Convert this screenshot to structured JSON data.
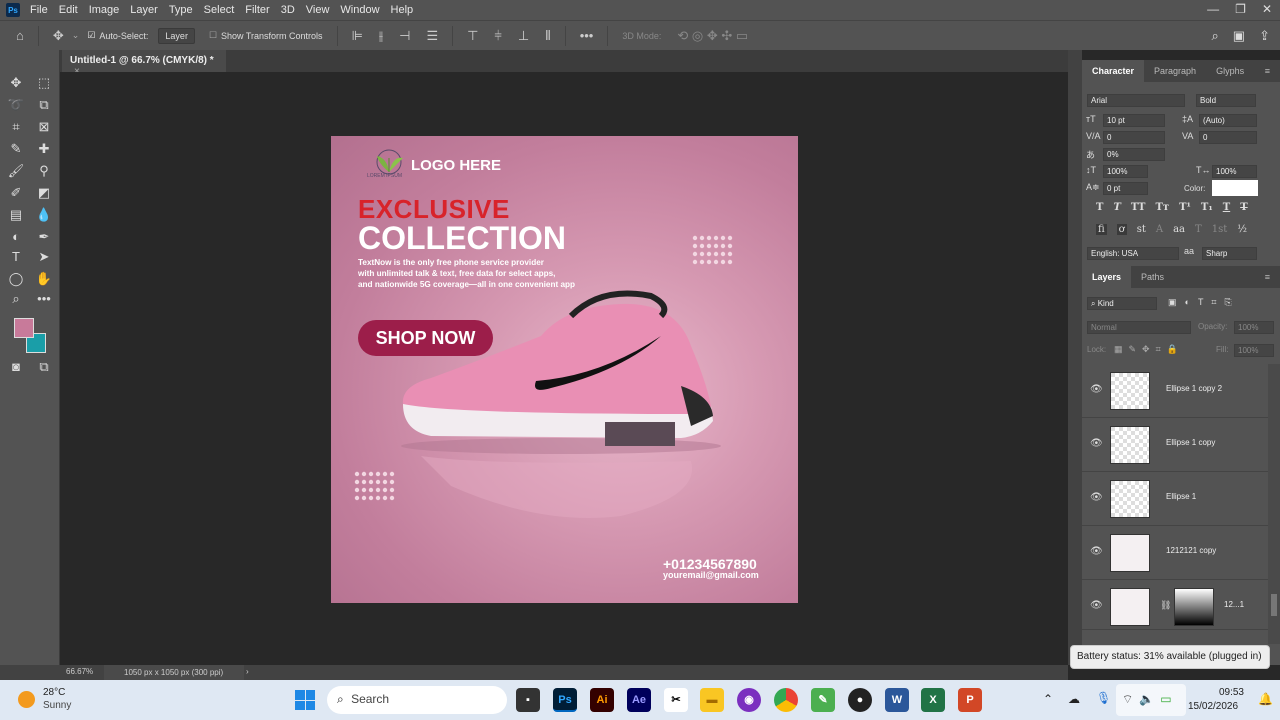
{
  "menu": [
    "File",
    "Edit",
    "Image",
    "Layer",
    "Type",
    "Select",
    "Filter",
    "3D",
    "View",
    "Window",
    "Help"
  ],
  "app_icon": "Ps",
  "options": {
    "auto_select_label": "Auto-Select:",
    "auto_select_value": "Layer",
    "show_transform": "Show Transform Controls",
    "mode_3d": "3D Mode:"
  },
  "document_tab": "Untitled-1 @ 66.7% (CMYK/8) *",
  "colors": {
    "foreground": "#c87a9a",
    "background": "#1a9ea8"
  },
  "design": {
    "logo_text": "LOGO HERE",
    "logo_caption": "LOREM IPSUM",
    "headline1": "EXCLUSIVE",
    "headline2": "COLLECTION",
    "body_lines": [
      "TextNow is the only free phone service provider",
      "with unlimited talk & text, free data for select apps,",
      "and nationwide 5G coverage—all in one convenient app"
    ],
    "cta": "SHOP NOW",
    "phone": "+01234567890",
    "email": "youremail@gmail.com"
  },
  "character": {
    "tabs": [
      "Character",
      "Paragraph",
      "Glyphs"
    ],
    "font": "Arial",
    "style": "Bold",
    "size": "10 pt",
    "leading": "(Auto)",
    "kerning": "0",
    "tracking": "0",
    "tsume": "0%",
    "vscale": "100%",
    "hscale": "100%",
    "baseline": "0 pt",
    "color_label": "Color:",
    "language": "English: USA",
    "antialias": "Sharp",
    "type_buttons": [
      "T",
      "T",
      "TT",
      "Tт",
      "T¹",
      "T₁",
      "T",
      "T"
    ],
    "opentype_buttons": [
      "ﬁ",
      "ơ",
      "st",
      "A",
      "aa",
      "T",
      "1st",
      "½"
    ]
  },
  "layers_panel": {
    "tabs": [
      "Layers",
      "Paths"
    ],
    "filter": "Kind",
    "blend": "Normal",
    "opacity_label": "Opacity:",
    "opacity": "100%",
    "lock_label": "Lock:",
    "fill_label": "Fill:",
    "fill": "100%",
    "layers": [
      "Ellipse 1 copy 2",
      "Ellipse 1 copy",
      "Ellipse 1",
      "1212121 copy",
      "12...1"
    ]
  },
  "status": {
    "zoom": "66.67%",
    "doc_size": "1050 px x 1050 px (300 ppi)"
  },
  "taskbar": {
    "temp": "28°C",
    "weather": "Sunny",
    "search": "Search",
    "time": "09:53",
    "date": "15/02/2026"
  },
  "tooltip": "Battery status: 31% available (plugged in)"
}
